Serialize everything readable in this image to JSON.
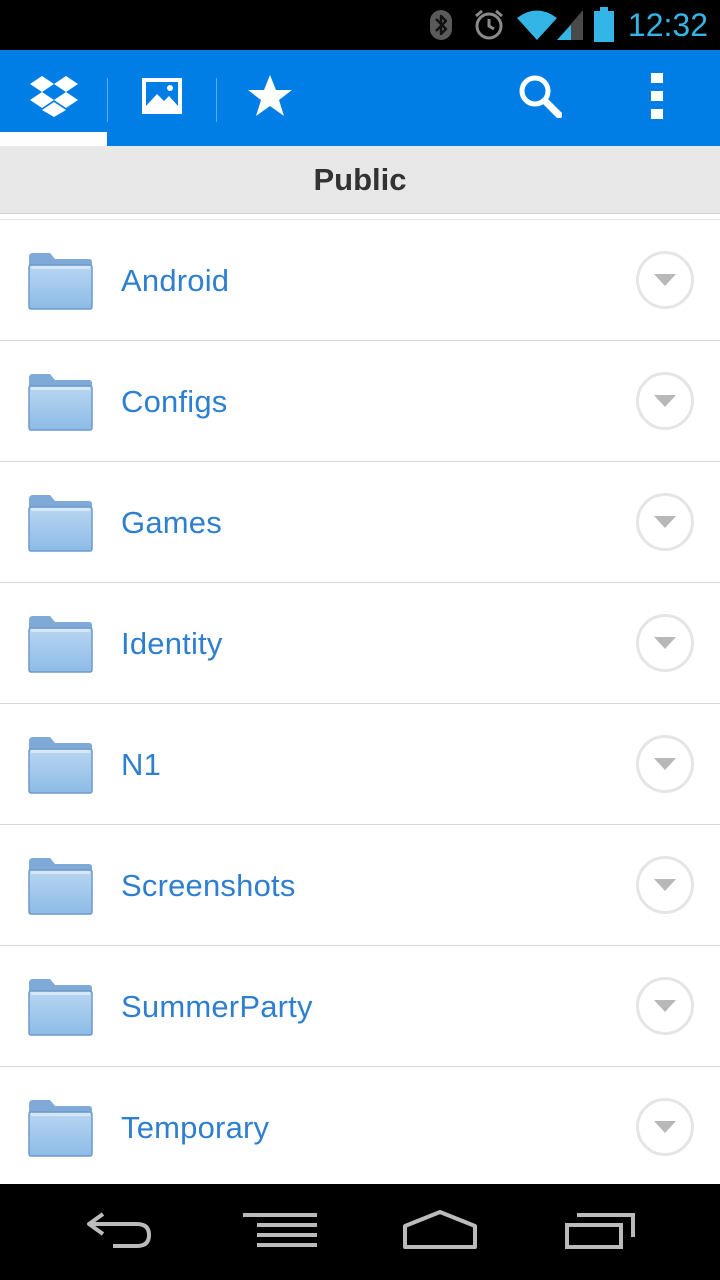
{
  "status_bar": {
    "time": "12:32",
    "icons": [
      "bluetooth-icon",
      "alarm-icon",
      "wifi-icon",
      "signal-icon",
      "battery-icon"
    ],
    "accent_color": "#33b5e5"
  },
  "action_bar": {
    "background_color": "#007ee5",
    "tabs": [
      {
        "icon": "dropbox-icon",
        "selected": true
      },
      {
        "icon": "photos-icon",
        "selected": false
      },
      {
        "icon": "star-icon",
        "selected": false
      }
    ],
    "actions": [
      "search-icon",
      "overflow-menu-icon"
    ]
  },
  "folder": {
    "title": "Public"
  },
  "files": [
    {
      "name": "Android",
      "type": "folder"
    },
    {
      "name": "Configs",
      "type": "folder"
    },
    {
      "name": "Games",
      "type": "folder"
    },
    {
      "name": "Identity",
      "type": "folder"
    },
    {
      "name": "N1",
      "type": "folder"
    },
    {
      "name": "Screenshots",
      "type": "folder"
    },
    {
      "name": "SummerParty",
      "type": "folder"
    },
    {
      "name": "Temporary",
      "type": "folder"
    }
  ],
  "nav_bar": {
    "buttons": [
      "back-icon",
      "menu-icon",
      "home-icon",
      "recent-apps-icon"
    ]
  },
  "colors": {
    "file_name": "#2f7fd0",
    "header_bg": "#e8e8e8"
  }
}
